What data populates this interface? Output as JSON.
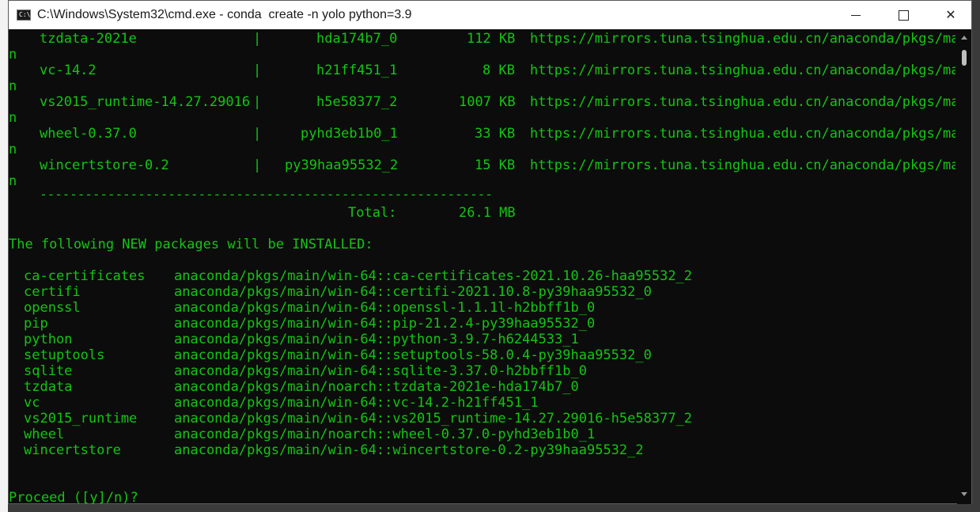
{
  "window": {
    "icon_text": "C:\\",
    "title": "C:\\Windows\\System32\\cmd.exe - conda  create -n yolo python=3.9"
  },
  "download_table": {
    "rows": [
      {
        "name": "tzdata-2021e",
        "sep": "|",
        "build": "hda174b7_0",
        "size": "112 KB",
        "url": "https://mirrors.tuna.tsinghua.edu.cn/anaconda/pkgs/mai",
        "wrap": "n"
      },
      {
        "name": "vc-14.2",
        "sep": "|",
        "build": "h21ff451_1",
        "size": "8 KB",
        "url": "https://mirrors.tuna.tsinghua.edu.cn/anaconda/pkgs/mai",
        "wrap": "n"
      },
      {
        "name": "vs2015_runtime-14.27.29016",
        "sep": "|",
        "build": "h5e58377_2",
        "size": "1007 KB",
        "url": "https://mirrors.tuna.tsinghua.edu.cn/anaconda/pkgs/mai",
        "wrap": "n"
      },
      {
        "name": "wheel-0.37.0",
        "sep": "|",
        "build": "pyhd3eb1b0_1",
        "size": "33 KB",
        "url": "https://mirrors.tuna.tsinghua.edu.cn/anaconda/pkgs/mai",
        "wrap": "n"
      },
      {
        "name": "wincertstore-0.2",
        "sep": "|",
        "build": "py39haa95532_2",
        "size": "15 KB",
        "url": "https://mirrors.tuna.tsinghua.edu.cn/anaconda/pkgs/mai",
        "wrap": "n"
      }
    ],
    "divider": "------------------------------------------------------------",
    "total_label": "Total:",
    "total_value": "26.1 MB"
  },
  "install_header": "The following NEW packages will be INSTALLED:",
  "packages": [
    {
      "name": "ca-certificates",
      "spec": "anaconda/pkgs/main/win-64::ca-certificates-2021.10.26-haa95532_2"
    },
    {
      "name": "certifi",
      "spec": "anaconda/pkgs/main/win-64::certifi-2021.10.8-py39haa95532_0"
    },
    {
      "name": "openssl",
      "spec": "anaconda/pkgs/main/win-64::openssl-1.1.1l-h2bbff1b_0"
    },
    {
      "name": "pip",
      "spec": "anaconda/pkgs/main/win-64::pip-21.2.4-py39haa95532_0"
    },
    {
      "name": "python",
      "spec": "anaconda/pkgs/main/win-64::python-3.9.7-h6244533_1"
    },
    {
      "name": "setuptools",
      "spec": "anaconda/pkgs/main/win-64::setuptools-58.0.4-py39haa95532_0"
    },
    {
      "name": "sqlite",
      "spec": "anaconda/pkgs/main/win-64::sqlite-3.37.0-h2bbff1b_0"
    },
    {
      "name": "tzdata",
      "spec": "anaconda/pkgs/main/noarch::tzdata-2021e-hda174b7_0"
    },
    {
      "name": "vc",
      "spec": "anaconda/pkgs/main/win-64::vc-14.2-h21ff451_1"
    },
    {
      "name": "vs2015_runtime",
      "spec": "anaconda/pkgs/main/win-64::vs2015_runtime-14.27.29016-h5e58377_2"
    },
    {
      "name": "wheel",
      "spec": "anaconda/pkgs/main/noarch::wheel-0.37.0-pyhd3eb1b0_1"
    },
    {
      "name": "wincertstore",
      "spec": "anaconda/pkgs/main/win-64::wincertstore-0.2-py39haa95532_2"
    }
  ],
  "prompt": "Proceed ([y]/n)?",
  "colors": {
    "terminal_text": "#13c513",
    "terminal_bg": "#0c0c0c",
    "titlebar_bg": "#ffffff"
  }
}
